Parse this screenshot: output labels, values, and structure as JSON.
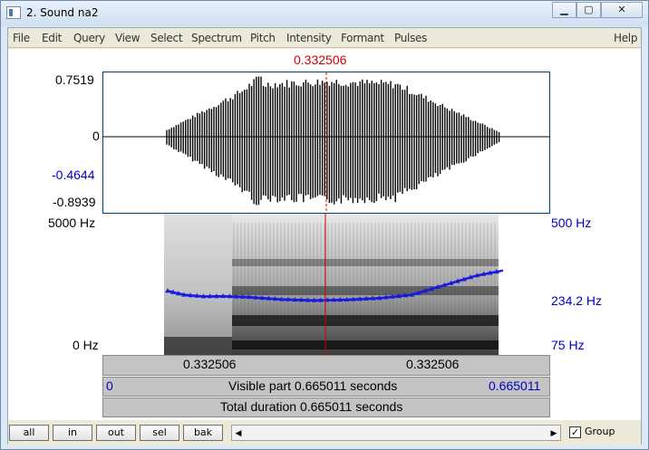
{
  "window": {
    "title": "2. Sound na2"
  },
  "menu": [
    "File",
    "Edit",
    "Query",
    "View",
    "Select",
    "Spectrum",
    "Pitch",
    "Intensity",
    "Formant",
    "Pulses",
    "Help"
  ],
  "cursor_time": "0.332506",
  "waveform": {
    "y_labels": {
      "top": "0.7519",
      "zero": "0",
      "cursor": "-0.4644",
      "bottom": "-0.8939"
    }
  },
  "spectrogram": {
    "left_labels": {
      "top": "5000 Hz",
      "bottom": "0 Hz"
    },
    "right_labels": {
      "top": "500 Hz",
      "mid": "234.2 Hz",
      "bottom": "75 Hz"
    }
  },
  "time_bar": {
    "left": "0.332506",
    "right": "0.332506"
  },
  "visible_bar": {
    "start": "0",
    "label": "Visible part 0.665011 seconds",
    "end": "0.665011"
  },
  "total_bar": {
    "label": "Total duration 0.665011 seconds"
  },
  "buttons": {
    "all": "all",
    "in": "in",
    "out": "out",
    "sel": "sel",
    "bak": "bak"
  },
  "group_label": "Group",
  "group_checked": true,
  "colors": {
    "cursor": "#d00000",
    "pitch": "#1a1adf",
    "axis_right": "#0000c0"
  },
  "pitch_track": {
    "range_hz": [
      75,
      500
    ],
    "time_range": [
      0.075,
      0.59
    ],
    "points": [
      [
        0.075,
        267
      ],
      [
        0.1,
        255
      ],
      [
        0.13,
        250
      ],
      [
        0.16,
        251
      ],
      [
        0.2,
        248
      ],
      [
        0.25,
        241
      ],
      [
        0.3,
        238
      ],
      [
        0.35,
        240
      ],
      [
        0.4,
        245
      ],
      [
        0.45,
        255
      ],
      [
        0.5,
        285
      ],
      [
        0.55,
        315
      ],
      [
        0.59,
        330
      ]
    ]
  }
}
